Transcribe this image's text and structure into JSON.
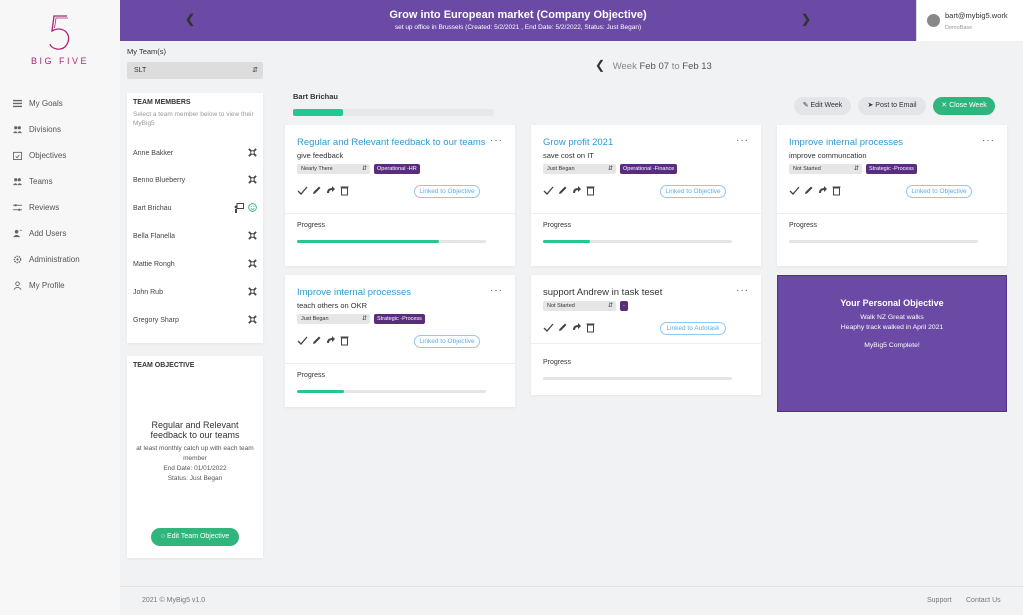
{
  "brand": {
    "logo_text": "BIG FIVE",
    "logo_color": "#b0247a"
  },
  "sidebar": {
    "items": [
      {
        "label": "My Goals",
        "icon": "bars-icon"
      },
      {
        "label": "Divisions",
        "icon": "people-icon"
      },
      {
        "label": "Objectives",
        "icon": "calendar-check-icon"
      },
      {
        "label": "Teams",
        "icon": "people-icon"
      },
      {
        "label": "Reviews",
        "icon": "sliders-icon"
      },
      {
        "label": "Add Users",
        "icon": "user-plus-icon"
      },
      {
        "label": "Administration",
        "icon": "gear-icon"
      },
      {
        "label": "My Profile",
        "icon": "user-icon"
      }
    ]
  },
  "topbar": {
    "title": "Grow into European market (Company Objective)",
    "subtitle": "set up office in Brussels (Created: 5/2/2021 , End Date: 5/2/2022, Status: Just Began)",
    "bg_color": "#6b4aa6"
  },
  "user": {
    "email": "bart@mybig5.work",
    "org": "DemoBase"
  },
  "team": {
    "label": "My Team(s)",
    "selected": "SLT"
  },
  "members": {
    "heading": "TEAM MEMBERS",
    "hint": "Select a team member below to view their MyBig5",
    "list": [
      {
        "name": "Anne Bakker"
      },
      {
        "name": "Benno Blueberry"
      },
      {
        "name": "Bart Brichau"
      },
      {
        "name": "Bella Flanella"
      },
      {
        "name": "Mattie Rongh"
      },
      {
        "name": "John Rub"
      },
      {
        "name": "Gregory Sharp"
      }
    ]
  },
  "team_objective": {
    "heading": "TEAM OBJECTIVE",
    "title": "Regular and Relevant feedback to our teams",
    "description": "at least monthly catch up with each team member",
    "end_date_label": "End Date:",
    "end_date": "01/01/2022",
    "status_label": "Status:",
    "status": "Just Began",
    "button": "Edit Team Objective"
  },
  "week": {
    "prefix": "Week",
    "start": "Feb 07",
    "to": "to",
    "end": "Feb 13"
  },
  "person": {
    "name": "Bart Brichau",
    "progress": 0.25
  },
  "actions": {
    "edit_week": "Edit Week",
    "post_email": "Post to Email",
    "close_week": "Close Week",
    "accent": "#30b67c"
  },
  "objectives": [
    {
      "title": "Regular and Relevant feedback to our teams",
      "subtitle": "give feedback",
      "status": "Nearly There",
      "tag": "Operational -HR",
      "link": "Linked to Objective",
      "progress_label": "Progress",
      "progress": 0.75
    },
    {
      "title": "Grow profit 2021",
      "subtitle": "save cost on IT",
      "status": "Just Began",
      "tag": "Operational -Finance",
      "link": "Linked to Objective",
      "progress_label": "Progress",
      "progress": 0.25
    },
    {
      "title": "Improve internal processes",
      "subtitle": "improve communcation",
      "status": "Not Started",
      "tag": "Strategic -Process",
      "link": "Linked to Objective",
      "progress_label": "Progress",
      "progress": 0
    },
    {
      "title": "Improve internal processes",
      "subtitle": "teach others on OKR",
      "status": "Just Began",
      "tag": "Strategic -Process",
      "link": "Linked to Objective",
      "progress_label": "Progress",
      "progress": 0.25
    },
    {
      "title": "support Andrew in task teset",
      "subtitle": "",
      "status": "Not Started",
      "tag": "-",
      "link": "Linked to Autotask",
      "progress_label": "Progress",
      "progress": 0
    }
  ],
  "personal_objective": {
    "heading": "Your Personal Objective",
    "line1": "Walk NZ Great walks",
    "line2": "Heaphy track walked in April 2021",
    "line3": "MyBig5 Complete!"
  },
  "footer": {
    "copyright": "2021 © MyBig5 v1.0",
    "support": "Support",
    "contact": "Contact Us"
  }
}
